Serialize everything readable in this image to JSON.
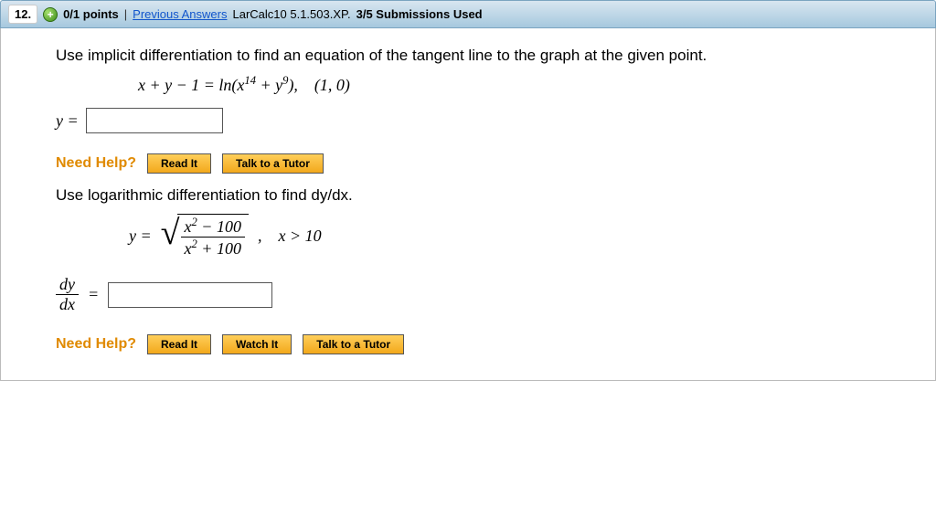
{
  "header": {
    "question_number": "12.",
    "points": "0/1 points",
    "separator": "|",
    "previous_link": "Previous Answers",
    "source": "LarCalc10 5.1.503.XP.",
    "submissions": "3/5 Submissions Used"
  },
  "q1": {
    "prompt": "Use implicit differentiation to find an equation of the tangent line to the graph at the given point.",
    "eq_lhs": "x + y − 1 = ln(x",
    "eq_exp1": "14",
    "eq_mid": " + y",
    "eq_exp2": "9",
    "eq_rhs": "), (1, 0)",
    "answer_label": "y =",
    "answer_value": ""
  },
  "help": {
    "label": "Need Help?",
    "read": "Read It",
    "watch": "Watch It",
    "tutor": "Talk to a Tutor"
  },
  "q2": {
    "prompt": "Use logarithmic differentiation to find dy/dx.",
    "y_equals": "y =",
    "num_a": "x",
    "num_exp": "2",
    "num_b": " − 100",
    "den_a": "x",
    "den_exp": "2",
    "den_b": " + 100",
    "condition": ", x > 10",
    "dy": "dy",
    "dx": "dx",
    "equals": "=",
    "answer_value": ""
  }
}
